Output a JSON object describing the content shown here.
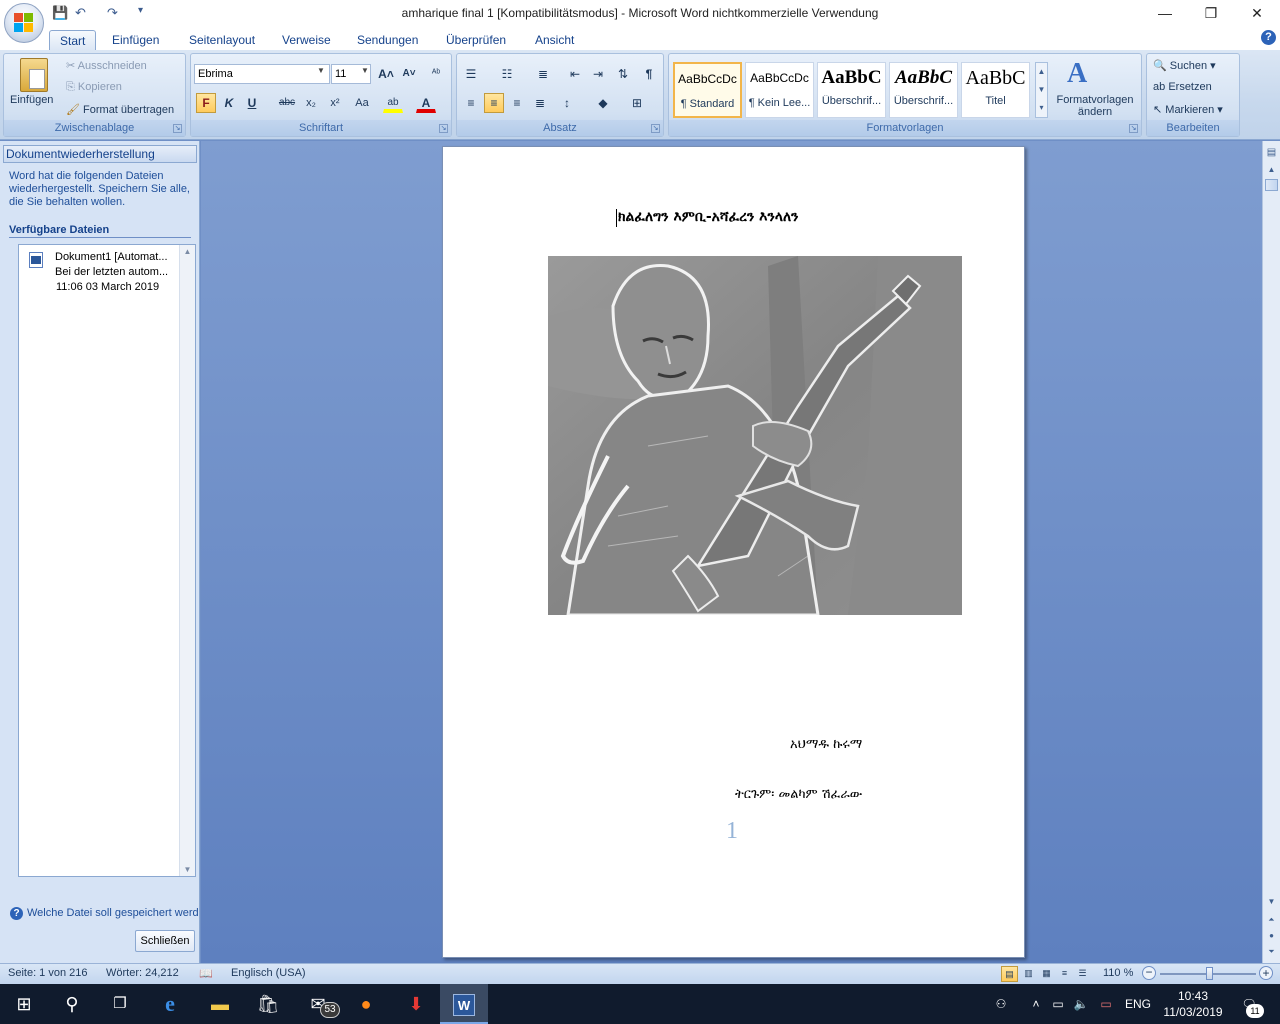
{
  "window": {
    "title": "amharique final 1 [Kompatibilitätsmodus] - Microsoft Word nichtkommerzielle Verwendung",
    "minimize_label": "—",
    "maximize_label": "❐",
    "close_label": "✕"
  },
  "quick_access": {
    "save": "💾",
    "undo": "↶",
    "redo": "↷",
    "customize": "▾"
  },
  "tabs": [
    "Start",
    "Einfügen",
    "Seitenlayout",
    "Verweise",
    "Sendungen",
    "Überprüfen",
    "Ansicht"
  ],
  "active_tab": "Start",
  "help_icon": "?",
  "ribbon": {
    "clipboard": {
      "title": "Zwischenablage",
      "paste": "Einfügen",
      "cut": "Ausschneiden",
      "copy": "Kopieren",
      "format_painter": "Format übertragen"
    },
    "font": {
      "title": "Schriftart",
      "font_name": "Ebrima",
      "font_size": "11",
      "grow": "A˄",
      "shrink": "A˅",
      "clear": "ᴬᵇ",
      "bold": "F",
      "italic": "K",
      "underline": "U",
      "strike": "abc",
      "subscript": "x₂",
      "superscript": "x²",
      "case": "Aa",
      "highlight": "ab",
      "font_color": "A"
    },
    "paragraph": {
      "title": "Absatz",
      "show_marks": "¶"
    },
    "styles": {
      "title": "Formatvorlagen",
      "items": [
        {
          "sample": "AaBbCcDc",
          "name": "¶ Standard"
        },
        {
          "sample": "AaBbCcDc",
          "name": "¶ Kein Lee..."
        },
        {
          "sample": "AaBbC",
          "name": "Überschrif..."
        },
        {
          "sample": "AaBbC",
          "name": "Überschrif..."
        },
        {
          "sample": "AaBbC",
          "name": "Titel"
        }
      ],
      "change_styles": "Formatvorlagen ändern"
    },
    "editing": {
      "title": "Bearbeiten",
      "find": "Suchen",
      "replace": "Ersetzen",
      "select": "Markieren"
    }
  },
  "recovery_pane": {
    "title": "Dokumentwiederherstellung",
    "message": "Word hat die folgenden Dateien wiederhergestellt. Speichern Sie alle, die Sie behalten wollen.",
    "available_files": "Verfügbare Dateien",
    "file": {
      "name": "Dokument1  [Automat...",
      "desc": "Bei der letzten autom...",
      "time": "11:06 03 March 2019"
    },
    "help_link": "Welche Datei soll gespeichert werden?",
    "close_button": "Schließen"
  },
  "document": {
    "title": "ክልፈለግን እምቢ-አሻፈረን እንላለን",
    "author": "አህማዱ ኩሩማ",
    "translator": "ትርጉም፡ መልካም ሽፈራው",
    "page_number": "1"
  },
  "status": {
    "page": "Seite: 1 von 216",
    "words": "Wörter: 24,212",
    "language": "Englisch (USA)",
    "zoom": "110 %",
    "zoom_level_percent": 110
  },
  "taskbar": {
    "mail_badge": "53",
    "lang": "ENG",
    "time": "10:43",
    "date": "11/03/2019",
    "notif_badge": "11"
  }
}
